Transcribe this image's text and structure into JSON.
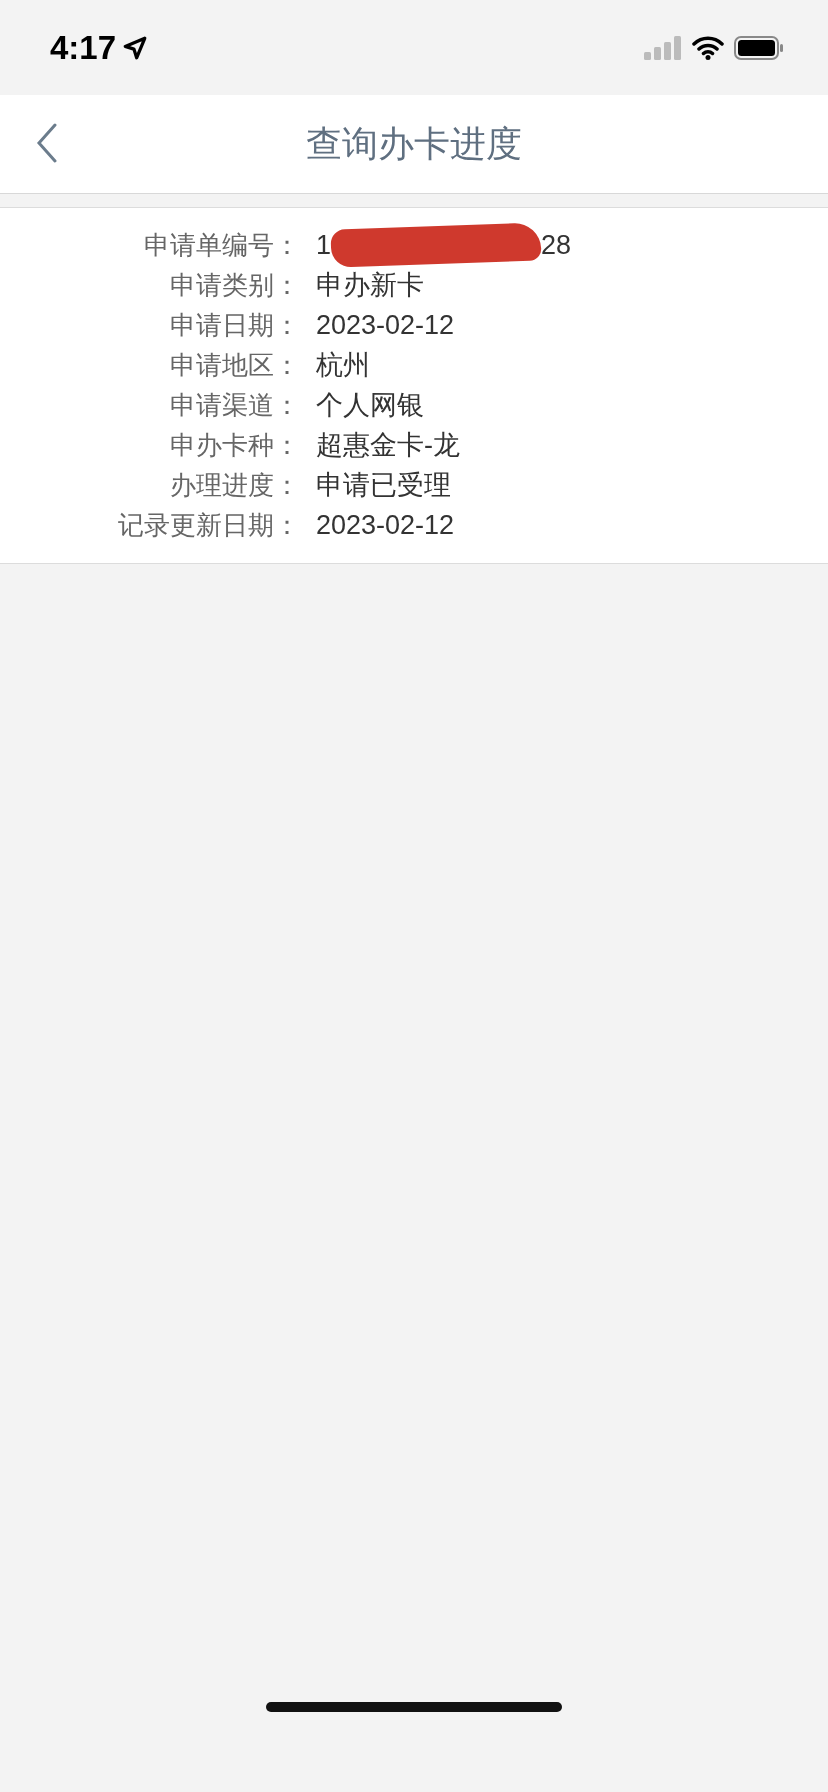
{
  "status_bar": {
    "time": "4:17",
    "location_on": true
  },
  "nav": {
    "title": "查询办卡进度"
  },
  "details": [
    {
      "label": "申请单编号：",
      "value": "1",
      "value_tail": "28",
      "redacted": true
    },
    {
      "label": "申请类别：",
      "value": "申办新卡"
    },
    {
      "label": "申请日期：",
      "value": "2023-02-12"
    },
    {
      "label": "申请地区：",
      "value": "杭州"
    },
    {
      "label": "申请渠道：",
      "value": "个人网银"
    },
    {
      "label": "申办卡种：",
      "value": "超惠金卡-龙"
    },
    {
      "label": "办理进度：",
      "value": "申请已受理"
    },
    {
      "label": "记录更新日期：",
      "value": "2023-02-12"
    }
  ]
}
